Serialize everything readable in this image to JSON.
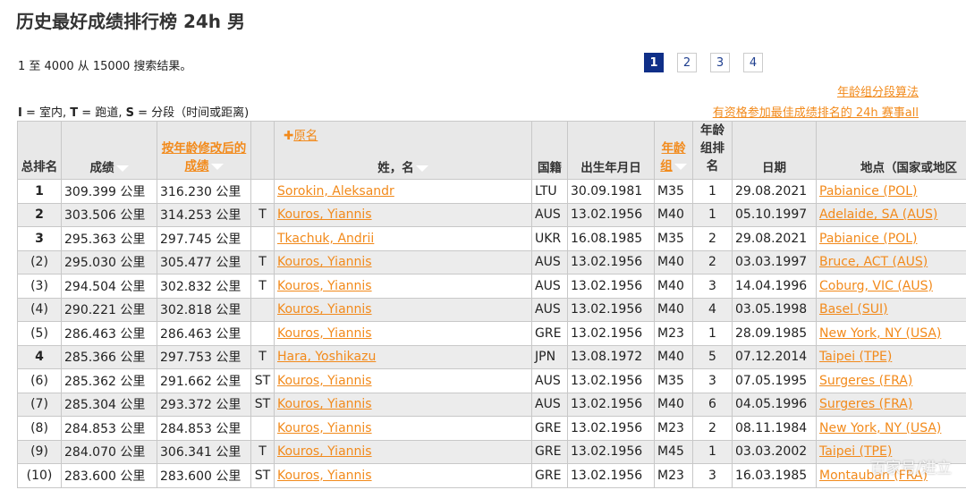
{
  "page": {
    "title": "历史最好成绩排行榜 24h 男",
    "result_count": "1 至 4000 从 15000 搜索结果。",
    "pages": [
      "1",
      "2",
      "3",
      "4"
    ],
    "active_page": "1",
    "links": {
      "age_grading": "年龄组分段算法",
      "eligible": "有资格参加最佳成绩排名的 24h 赛事all"
    },
    "legend": {
      "i_key": "I",
      "i_text": " = 室内, ",
      "t_key": "T",
      "t_text": " = 跑道, ",
      "s_key": "S",
      "s_text": " = 分段（时间或距离)"
    }
  },
  "table": {
    "headers": {
      "rank": "总排名",
      "performance": "成绩",
      "age_graded": "按年龄修改后的成绩",
      "orig_name": "原名",
      "name": "姓，名",
      "nat": "国籍",
      "dob": "出生年月日",
      "age_group": "年龄组",
      "age_rank": "年龄组排名",
      "date": "日期",
      "location": "地点（国家或地区"
    },
    "rows": [
      {
        "rank": "1",
        "perf": "309.399 公里",
        "graded": "316.230 公里",
        "flag": "",
        "name": "Sorokin, Aleksandr",
        "nat": "LTU",
        "dob": "30.09.1981",
        "ag": "M35",
        "agr": "1",
        "date": "29.08.2021",
        "loc": "Pabianice (POL)"
      },
      {
        "rank": "2",
        "perf": "303.506 公里",
        "graded": "314.253 公里",
        "flag": "T",
        "name": "Kouros, Yiannis",
        "nat": "AUS",
        "dob": "13.02.1956",
        "ag": "M40",
        "agr": "1",
        "date": "05.10.1997",
        "loc": "Adelaide, SA (AUS)"
      },
      {
        "rank": "3",
        "perf": "295.363 公里",
        "graded": "297.745 公里",
        "flag": "",
        "name": "Tkachuk, Andrii",
        "nat": "UKR",
        "dob": "16.08.1985",
        "ag": "M35",
        "agr": "2",
        "date": "29.08.2021",
        "loc": "Pabianice (POL)"
      },
      {
        "rank": "(2)",
        "perf": "295.030 公里",
        "graded": "305.477 公里",
        "flag": "T",
        "name": "Kouros, Yiannis",
        "nat": "AUS",
        "dob": "13.02.1956",
        "ag": "M40",
        "agr": "2",
        "date": "03.03.1997",
        "loc": "Bruce, ACT (AUS)"
      },
      {
        "rank": "(3)",
        "perf": "294.504 公里",
        "graded": "302.832 公里",
        "flag": "T",
        "name": "Kouros, Yiannis",
        "nat": "AUS",
        "dob": "13.02.1956",
        "ag": "M40",
        "agr": "3",
        "date": "14.04.1996",
        "loc": "Coburg, VIC (AUS)"
      },
      {
        "rank": "(4)",
        "perf": "290.221 公里",
        "graded": "302.818 公里",
        "flag": "",
        "name": "Kouros, Yiannis",
        "nat": "AUS",
        "dob": "13.02.1956",
        "ag": "M40",
        "agr": "4",
        "date": "03.05.1998",
        "loc": "Basel (SUI)"
      },
      {
        "rank": "(5)",
        "perf": "286.463 公里",
        "graded": "286.463 公里",
        "flag": "",
        "name": "Kouros, Yiannis",
        "nat": "GRE",
        "dob": "13.02.1956",
        "ag": "M23",
        "agr": "1",
        "date": "28.09.1985",
        "loc": "New York, NY (USA)"
      },
      {
        "rank": "4",
        "perf": "285.366 公里",
        "graded": "297.753 公里",
        "flag": "T",
        "name": "Hara, Yoshikazu",
        "nat": "JPN",
        "dob": "13.08.1972",
        "ag": "M40",
        "agr": "5",
        "date": "07.12.2014",
        "loc": "Taipei (TPE)"
      },
      {
        "rank": "(6)",
        "perf": "285.362 公里",
        "graded": "291.662 公里",
        "flag": "ST",
        "name": "Kouros, Yiannis",
        "nat": "AUS",
        "dob": "13.02.1956",
        "ag": "M35",
        "agr": "3",
        "date": "07.05.1995",
        "loc": "Surgeres (FRA)"
      },
      {
        "rank": "(7)",
        "perf": "285.304 公里",
        "graded": "293.372 公里",
        "flag": "ST",
        "name": "Kouros, Yiannis",
        "nat": "AUS",
        "dob": "13.02.1956",
        "ag": "M40",
        "agr": "6",
        "date": "04.05.1996",
        "loc": "Surgeres (FRA)"
      },
      {
        "rank": "(8)",
        "perf": "284.853 公里",
        "graded": "284.853 公里",
        "flag": "",
        "name": "Kouros, Yiannis",
        "nat": "GRE",
        "dob": "13.02.1956",
        "ag": "M23",
        "agr": "2",
        "date": "08.11.1984",
        "loc": "New York, NY (USA)"
      },
      {
        "rank": "(9)",
        "perf": "284.070 公里",
        "graded": "306.341 公里",
        "flag": "T",
        "name": "Kouros, Yiannis",
        "nat": "GRE",
        "dob": "13.02.1956",
        "ag": "M45",
        "agr": "1",
        "date": "03.03.2002",
        "loc": "Taipei (TPE)"
      },
      {
        "rank": "(10)",
        "perf": "283.600 公里",
        "graded": "283.600 公里",
        "flag": "ST",
        "name": "Kouros, Yiannis",
        "nat": "GRE",
        "dob": "13.02.1956",
        "ag": "M23",
        "agr": "3",
        "date": "16.03.1985",
        "loc": "Montauban (FRA)"
      }
    ]
  },
  "watermark": "百家号/进立",
  "colors": {
    "accent": "#f28a1b",
    "active_page": "#0f2f88",
    "header_bg": "#e8e8e8",
    "alt_row": "#ececec"
  }
}
